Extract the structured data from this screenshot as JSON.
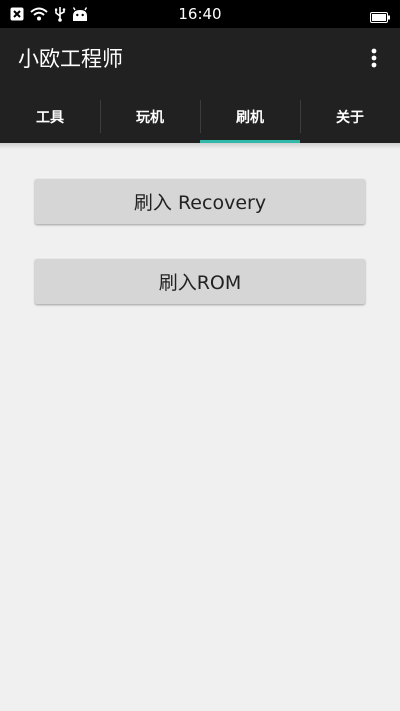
{
  "status_bar": {
    "time": "16:40",
    "icons": [
      "close-box-icon",
      "wifi-icon",
      "usb-icon",
      "android-icon",
      "battery-icon"
    ]
  },
  "app_bar": {
    "title": "小欧工程师",
    "menu_icon": "more-vert-icon"
  },
  "tabs": [
    {
      "label": "工具",
      "selected": false
    },
    {
      "label": "玩机",
      "selected": false
    },
    {
      "label": "刷机",
      "selected": true
    },
    {
      "label": "关于",
      "selected": false
    }
  ],
  "main": {
    "flash_recovery_label": "刷入 Recovery",
    "flash_rom_label": "刷入ROM"
  },
  "colors": {
    "status_bar": "#000000",
    "app_bar": "#212121",
    "tab_indicator": "#30b8a8",
    "background": "#f0f0f0",
    "button": "#d6d6d6"
  }
}
